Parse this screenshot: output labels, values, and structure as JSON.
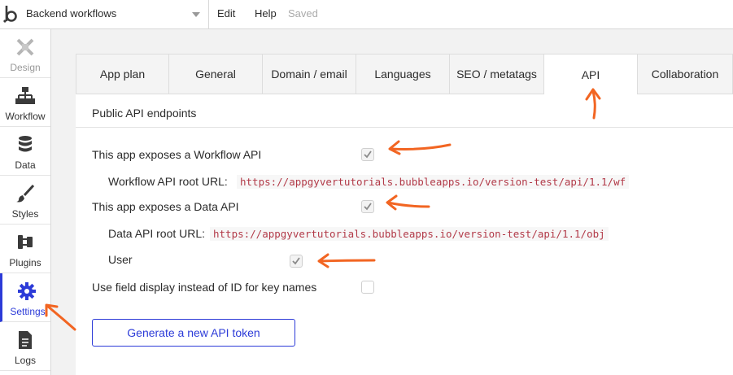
{
  "topbar": {
    "page_name": "Backend workflows",
    "menu_edit": "Edit",
    "menu_help": "Help",
    "status": "Saved"
  },
  "sidebar": {
    "items": [
      {
        "label": "Design",
        "icon": "design-icon"
      },
      {
        "label": "Workflow",
        "icon": "workflow-icon"
      },
      {
        "label": "Data",
        "icon": "database-icon"
      },
      {
        "label": "Styles",
        "icon": "brush-icon"
      },
      {
        "label": "Plugins",
        "icon": "plug-icon"
      },
      {
        "label": "Settings",
        "icon": "gear-icon",
        "active": true
      },
      {
        "label": "Logs",
        "icon": "document-icon"
      }
    ]
  },
  "tabs": [
    {
      "label": "App plan"
    },
    {
      "label": "General"
    },
    {
      "label": "Domain / email"
    },
    {
      "label": "Languages"
    },
    {
      "label": "SEO / metatags"
    },
    {
      "label": "API",
      "active": true
    },
    {
      "label": "Collaboration"
    }
  ],
  "api": {
    "section_title": "Public API endpoints",
    "workflow_api_label": "This app exposes a Workflow API",
    "workflow_api_checked": true,
    "workflow_root_label": "Workflow API root URL:",
    "workflow_root_url": "https://appgyvertutorials.bubbleapps.io/version-test/api/1.1/wf",
    "data_api_label": "This app exposes a Data API",
    "data_api_checked": true,
    "data_root_label": "Data API root URL:",
    "data_root_url": "https://appgyvertutorials.bubbleapps.io/version-test/api/1.1/obj",
    "user_label": "User",
    "user_checked": true,
    "field_display_label": "Use field display instead of ID for key names",
    "field_display_checked": false,
    "generate_token_label": "Generate a new API token"
  },
  "colors": {
    "accent": "#2c3bd8",
    "annotation_arrow": "#f26522",
    "url_text": "#b23a48"
  }
}
